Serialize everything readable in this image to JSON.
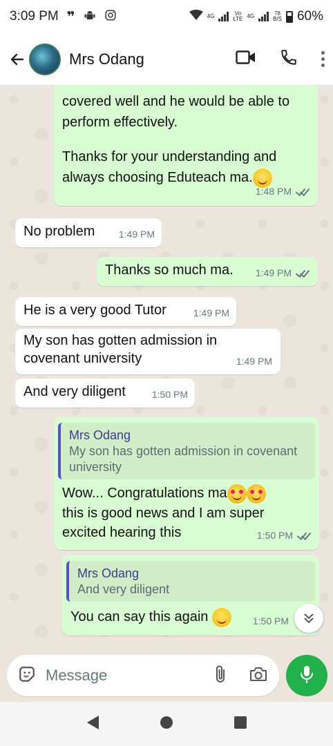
{
  "status_bar": {
    "time": "3:09 PM",
    "net_top": "4G",
    "volte_top": "Vo",
    "volte_bottom": "LTE",
    "net2_top": "4G",
    "speed_top": "78",
    "speed_bottom": "B/S",
    "battery": "60%"
  },
  "header": {
    "contact_name": "Mrs Odang"
  },
  "messages": [
    {
      "lines": [
        "covered well and he would be able to",
        "perform effectively."
      ],
      "para2": [
        "Thanks for your understanding and",
        "always choosing Eduteach ma."
      ],
      "time": "1:48 PM"
    },
    {
      "text": "No problem",
      "time": "1:49 PM"
    },
    {
      "text": "Thanks so much ma.",
      "time": "1:49 PM"
    },
    {
      "text": "He is a very good Tutor",
      "time": "1:49 PM"
    },
    {
      "lines": [
        "My son has gotten admission in",
        "covenant university"
      ],
      "time": "1:49 PM"
    },
    {
      "text": "And very diligent",
      "time": "1:50 PM"
    },
    {
      "quote_name": "Mrs Odang",
      "quote_lines": [
        "My son has gotten admission in covenant",
        "university"
      ],
      "lines": [
        "Wow... Congratulations ma",
        "this is good news and I am super",
        "excited hearing this"
      ],
      "time": "1:50 PM"
    },
    {
      "quote_name": "Mrs Odang",
      "quote_text": "And very diligent",
      "text": "You can say this again",
      "time": "1:50 PM"
    }
  ],
  "composer": {
    "placeholder": "Message"
  },
  "colors": {
    "outgoing_bubble": "#d9fdd3",
    "incoming_bubble": "#ffffff",
    "mic_button": "#22b04b",
    "chat_background": "#ece5dd"
  },
  "icons": [
    "back-arrow-icon",
    "video-call-icon",
    "phone-icon",
    "more-options-icon",
    "emoji-sticker-icon",
    "attach-icon",
    "camera-icon",
    "mic-icon",
    "scroll-down-icon",
    "nav-back-icon",
    "nav-home-icon",
    "nav-recents-icon"
  ]
}
